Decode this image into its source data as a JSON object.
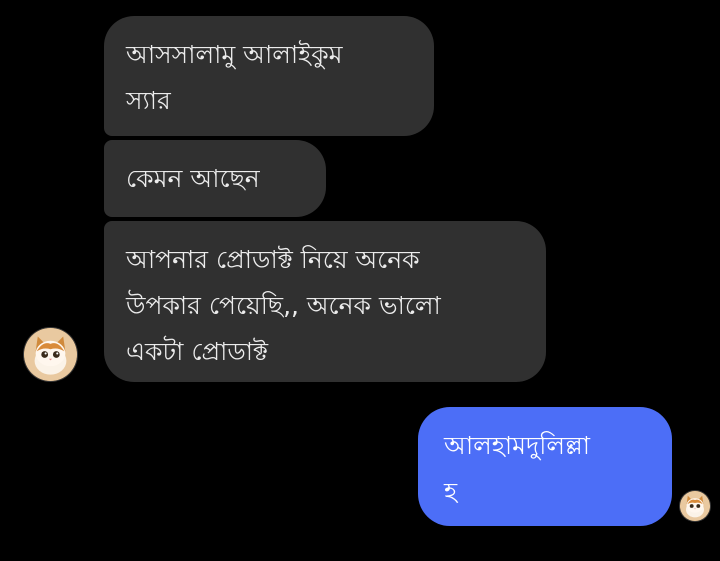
{
  "conversation": {
    "messages": [
      {
        "sender": "contact",
        "text": "আসসালামু আলাইকুম\nস্যার"
      },
      {
        "sender": "contact",
        "text": "কেমন আছেন"
      },
      {
        "sender": "contact",
        "text": "আপনার প্রোডাক্ট নিয়ে অনেক\nউপকার পেয়েছি,, অনেক ভালো\nএকটা প্রোডাক্ট"
      },
      {
        "sender": "self",
        "text": "আলহামদুলিল্লা\nহ"
      }
    ],
    "avatars": {
      "contact": "kitten-avatar-icon",
      "self": "kitten-avatar-icon"
    }
  },
  "colors": {
    "background": "#000000",
    "incoming_bubble": "#303030",
    "outgoing_bubble": "#4c6ef7",
    "text": "#ececec"
  }
}
